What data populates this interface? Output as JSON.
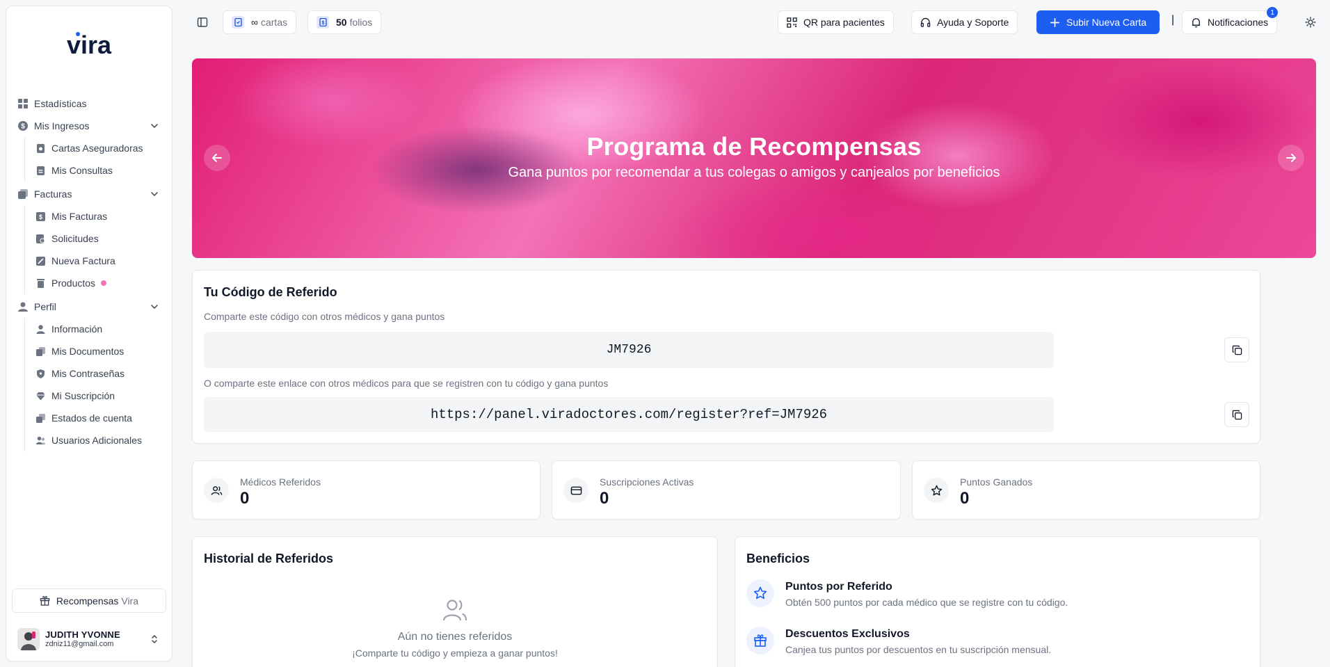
{
  "brand": {
    "logo_text": "vira"
  },
  "sidebar": {
    "items": [
      {
        "label": "Estadísticas"
      },
      {
        "label": "Mis Ingresos",
        "children": [
          {
            "label": "Cartas Aseguradoras"
          },
          {
            "label": "Mis Consultas"
          }
        ]
      },
      {
        "label": "Facturas",
        "children": [
          {
            "label": "Mis Facturas"
          },
          {
            "label": "Solicitudes"
          },
          {
            "label": "Nueva Factura"
          },
          {
            "label": "Productos"
          }
        ]
      },
      {
        "label": "Perfil",
        "children": [
          {
            "label": "Información"
          },
          {
            "label": "Mis Documentos"
          },
          {
            "label": "Mis Contraseñas"
          },
          {
            "label": "Mi Suscripción"
          },
          {
            "label": "Estados de cuenta"
          },
          {
            "label": "Usuarios Adicionales"
          }
        ]
      }
    ],
    "rewards": {
      "label": "Recompensas",
      "brand": "Vira"
    },
    "user": {
      "name": "JUDITH YVONNE",
      "email": "zdniz11@gmail.com"
    }
  },
  "topbar": {
    "cartas": {
      "value": "∞",
      "label": "cartas"
    },
    "folios": {
      "value": "50",
      "label": "folios"
    },
    "qr_label": "QR para pacientes",
    "help_label": "Ayuda y Soporte",
    "upload_label": "Subir Nueva Carta",
    "separator": "|",
    "notifications_label": "Notificaciones",
    "notifications_count": "1"
  },
  "banner": {
    "title": "Programa de Recompensas",
    "subtitle": "Gana puntos por recomendar a tus colegas o amigos y canjealos por beneficios"
  },
  "referral": {
    "title": "Tu Código de Referido",
    "code_hint": "Comparte este código con otros médicos y gana puntos",
    "code": "JM7926",
    "link_hint": "O comparte este enlace con otros médicos para que se registren con tu código y gana puntos",
    "link": "https://panel.viradoctores.com/register?ref=JM7926"
  },
  "stats": [
    {
      "label": "Médicos Referidos",
      "value": "0",
      "icon": "users-icon"
    },
    {
      "label": "Suscripciones Activas",
      "value": "0",
      "icon": "credit-card-icon"
    },
    {
      "label": "Puntos Ganados",
      "value": "0",
      "icon": "star-icon"
    }
  ],
  "history": {
    "title": "Historial de Referidos",
    "empty_title": "Aún no tienes referidos",
    "empty_sub": "¡Comparte tu código y empieza a ganar puntos!"
  },
  "benefits": {
    "title": "Beneficios",
    "items": [
      {
        "title": "Puntos por Referido",
        "desc": "Obtén 500 puntos por cada médico que se registre con tu código.",
        "icon": "star-icon"
      },
      {
        "title": "Descuentos Exclusivos",
        "desc": "Canjea tus puntos por descuentos en tu suscripción mensual.",
        "icon": "gift-icon"
      }
    ]
  },
  "colors": {
    "primary": "#1d5ef0",
    "accent_pink": "#f472b6",
    "banner": "#e11d74"
  }
}
